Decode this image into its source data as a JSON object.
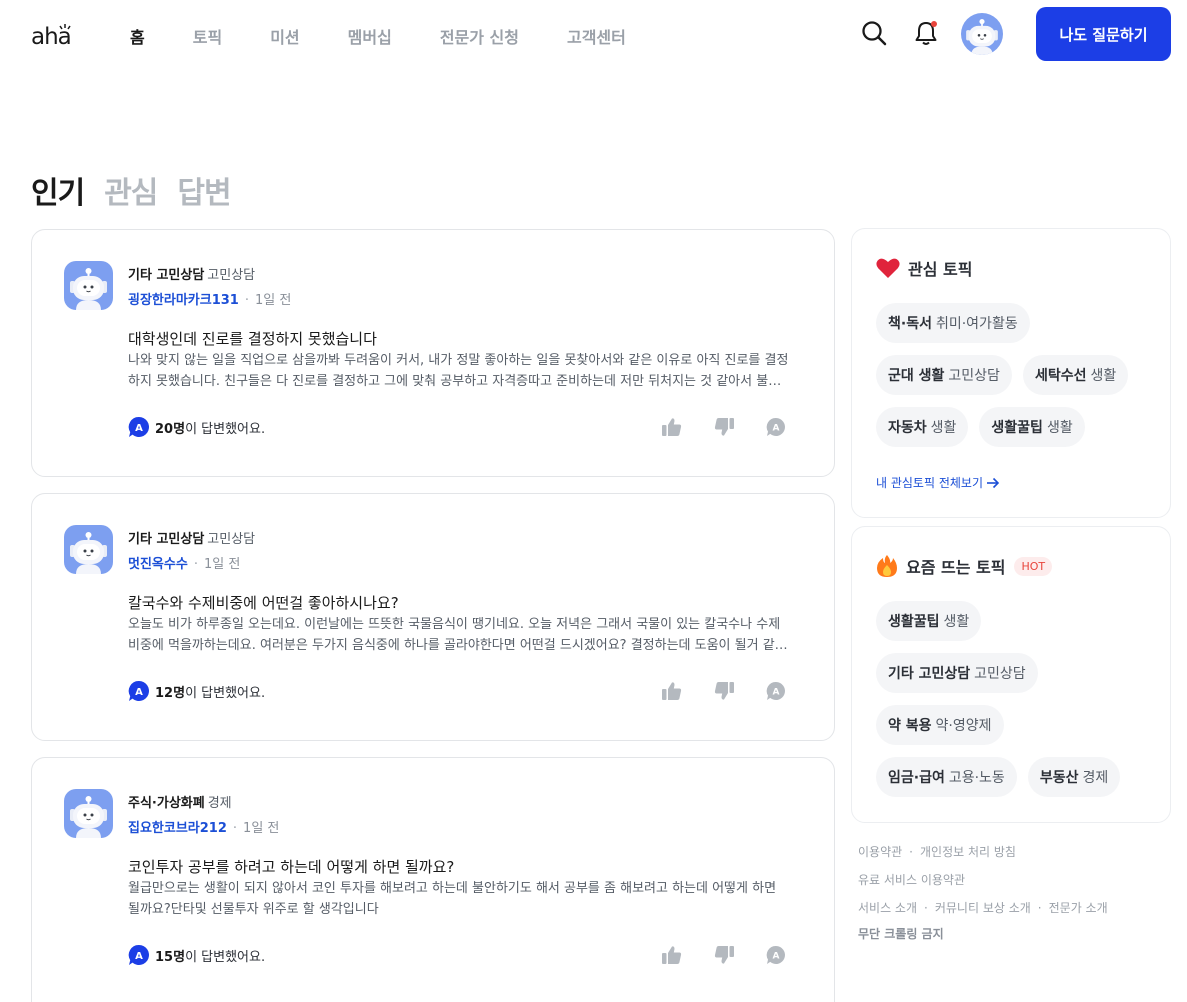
{
  "header": {
    "logo_text": "aha",
    "nav": [
      "홈",
      "토픽",
      "미션",
      "멤버십",
      "전문가 신청",
      "고객센터"
    ],
    "active_nav": "홈",
    "ask_button": "나도 질문하기",
    "icons": [
      "search-icon",
      "bell-icon",
      "avatar"
    ]
  },
  "tabs": [
    "인기",
    "관심",
    "답변"
  ],
  "active_tab": "인기",
  "questions": [
    {
      "topic": "기타 고민상담",
      "category": "고민상담",
      "author": "굉장한라마카크131",
      "time": "1일 전",
      "title": "대학생인데 진로를 결정하지 못했습니다",
      "body": "나와 맞지 않는 일을 직업으로 삼을까봐 두려움이 커서, 내가 정말 좋아하는 일을 못찾아서와 같은 이유로 아직 진로를 결정하지 못했습니다. 친구들은 다 진로를 결정하고 그에 맞춰 공부하고 자격증따고 준비하는데 저만 뒤처지는 것 같아서 불안합니다.",
      "answer_count": "20명",
      "answer_suffix": "이 답변했어요."
    },
    {
      "topic": "기타 고민상담",
      "category": "고민상담",
      "author": "멋진옥수수",
      "time": "1일 전",
      "title": "칼국수와 수제비중에 어떤걸 좋아하시나요?",
      "body": "오늘도 비가 하루종일 오는데요. 이런날에는 뜨뜻한 국물음식이 땡기네요. 오늘 저녁은 그래서 국물이 있는 칼국수나 수제비중에 먹을까하는데요. 여러분은 두가지 음식중에 하나를 골라야한다면 어떤걸 드시겠어요? 결정하는데 도움이 될거 같습니다.",
      "answer_count": "12명",
      "answer_suffix": "이 답변했어요."
    },
    {
      "topic": "주식·가상화폐",
      "category": "경제",
      "author": "집요한코브라212",
      "time": "1일 전",
      "title": "코인투자 공부를 하려고 하는데 어떻게 하면 될까요?",
      "body": "월급만으로는 생활이 되지 않아서 코인 투자를 해보려고 하는데 불안하기도 해서 공부를 좀 해보려고 하는데 어떻게 하면 될까요?단타및 선물투자 위주로 할 생각입니다",
      "answer_count": "15명",
      "answer_suffix": "이 답변했어요."
    }
  ],
  "interest_topics": {
    "title": "관심 토픽",
    "icon": "heart-icon",
    "chips": [
      {
        "name": "책·독서",
        "category": "취미·여가활동"
      },
      {
        "name": "군대 생활",
        "category": "고민상담"
      },
      {
        "name": "세탁수선",
        "category": "생활"
      },
      {
        "name": "자동차",
        "category": "생활"
      },
      {
        "name": "생활꿀팁",
        "category": "생활"
      }
    ],
    "view_all": "내 관심토픽 전체보기"
  },
  "trending_topics": {
    "title": "요즘 뜨는 토픽",
    "icon": "fire-icon",
    "badge": "HOT",
    "chips": [
      {
        "name": "생활꿀팁",
        "category": "생활"
      },
      {
        "name": "기타 고민상담",
        "category": "고민상담"
      },
      {
        "name": "약 복용",
        "category": "약·영양제"
      },
      {
        "name": "임금·급여",
        "category": "고용·노동"
      },
      {
        "name": "부동산",
        "category": "경제"
      }
    ]
  },
  "footer": {
    "terms": "이용약관",
    "privacy": "개인정보 처리 방침",
    "paid_terms": "유료 서비스 이용약관",
    "service_intro": "서비스 소개",
    "reward_intro": "커뮤니티 보상 소개",
    "expert_intro": "전문가 소개",
    "no_crawling": "무단 크롤링 금지"
  },
  "colors": {
    "accent": "#1c3ee6",
    "author_link": "#1c4fd6",
    "hot": "#e8453c",
    "heart": "#e0243c",
    "muted": "#9aa0a8"
  }
}
